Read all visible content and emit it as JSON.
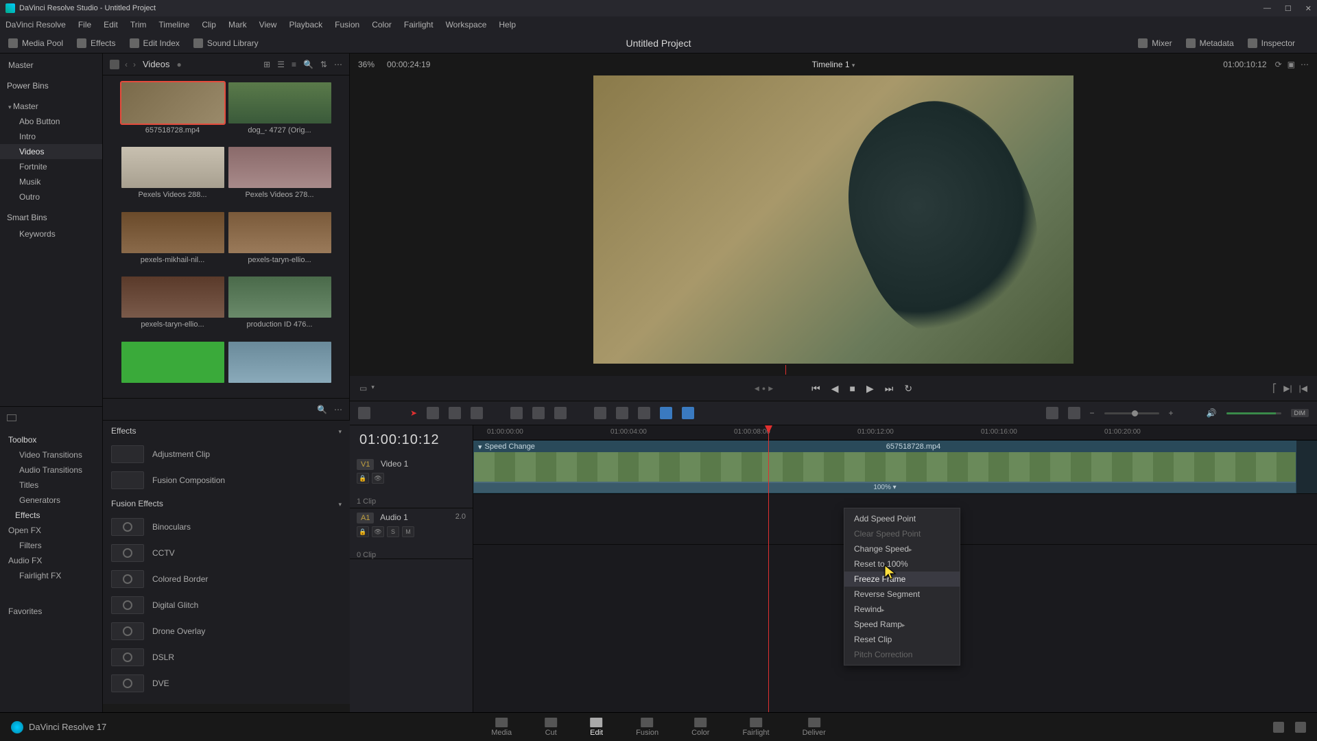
{
  "titlebar": {
    "text": "DaVinci Resolve Studio - Untitled Project"
  },
  "menu": [
    "DaVinci Resolve",
    "File",
    "Edit",
    "Trim",
    "Timeline",
    "Clip",
    "Mark",
    "View",
    "Playback",
    "Fusion",
    "Color",
    "Fairlight",
    "Workspace",
    "Help"
  ],
  "toolbar": {
    "media_pool": "Media Pool",
    "effects": "Effects",
    "edit_index": "Edit Index",
    "sound_library": "Sound Library",
    "mixer": "Mixer",
    "metadata": "Metadata",
    "inspector": "Inspector",
    "project_title": "Untitled Project"
  },
  "viewer_header": {
    "zoom": "36%",
    "tc_left": "00:00:24:19",
    "timeline_name": "Timeline 1",
    "tc_right": "01:00:10:12"
  },
  "media_header": {
    "crumb": "Videos"
  },
  "bins": {
    "master": "Master",
    "power": "Power Bins",
    "pb_master": "Master",
    "items": [
      "Abo Button",
      "Intro",
      "Videos",
      "Fortnite",
      "Musik",
      "Outro"
    ],
    "smart": "Smart Bins",
    "keywords": "Keywords"
  },
  "thumbs": [
    {
      "label": "657518728.mp4",
      "cls": "bg-bike",
      "sel": true
    },
    {
      "label": "dog_- 4727 (Orig...",
      "cls": "bg-dog"
    },
    {
      "label": "Pexels Videos 288...",
      "cls": "bg-wed"
    },
    {
      "label": "Pexels Videos 278...",
      "cls": "bg-fit"
    },
    {
      "label": "pexels-mikhail-nil...",
      "cls": "bg-for"
    },
    {
      "label": "pexels-taryn-ellio...",
      "cls": "bg-for2"
    },
    {
      "label": "pexels-taryn-ellio...",
      "cls": "bg-tree"
    },
    {
      "label": "production ID 476...",
      "cls": "bg-mnt"
    },
    {
      "label": "",
      "cls": "bg-grn"
    },
    {
      "label": "",
      "cls": "bg-face"
    }
  ],
  "efftree": {
    "toolbox": "Toolbox",
    "items1": [
      "Video Transitions",
      "Audio Transitions",
      "Titles",
      "Generators"
    ],
    "effects": "Effects",
    "openfx": "Open FX",
    "filters": "Filters",
    "audiofx": "Audio FX",
    "fairlightfx": "Fairlight FX",
    "favorites": "Favorites"
  },
  "effects_panel": {
    "h1": "Effects",
    "items_a": [
      "Adjustment Clip",
      "Fusion Composition"
    ],
    "h2": "Fusion Effects",
    "items_b": [
      "Binoculars",
      "CCTV",
      "Colored Border",
      "Digital Glitch",
      "Drone Overlay",
      "DSLR",
      "DVE"
    ]
  },
  "timeline": {
    "bigtc": "01:00:10:12",
    "v1": "V1",
    "video1": "Video 1",
    "v1sub": "1 Clip",
    "a1": "A1",
    "audio1": "Audio 1",
    "a1val": "2.0",
    "a1sub": "0 Clip",
    "ruler": [
      "01:00:00:00",
      "01:00:04:00",
      "01:00:08:00",
      "01:00:12:00",
      "01:00:16:00",
      "01:00:20:00"
    ],
    "clip_title": "Speed Change",
    "clip_name": "657518728.mp4",
    "speed_label": "100% ▾",
    "btn_lock": "🔒",
    "btn_eye": "👁",
    "btn_s": "S",
    "btn_m": "M"
  },
  "context_menu": {
    "items": [
      {
        "label": "Add Speed Point",
        "dis": false,
        "sub": false
      },
      {
        "label": "Clear Speed Point",
        "dis": true,
        "sub": false
      },
      {
        "label": "Change Speed",
        "dis": false,
        "sub": true
      },
      {
        "label": "Reset to 100%",
        "dis": false,
        "sub": false
      },
      {
        "label": "Freeze Frame",
        "dis": false,
        "sub": false,
        "hl": true
      },
      {
        "label": "Reverse Segment",
        "dis": false,
        "sub": false
      },
      {
        "label": "Rewind",
        "dis": false,
        "sub": true
      },
      {
        "label": "Speed Ramp",
        "dis": false,
        "sub": true
      },
      {
        "label": "Reset Clip",
        "dis": false,
        "sub": false
      },
      {
        "label": "Pitch Correction",
        "dis": true,
        "sub": false
      }
    ]
  },
  "bottom": {
    "app": "DaVinci Resolve 17",
    "pages": [
      "Media",
      "Cut",
      "Edit",
      "Fusion",
      "Color",
      "Fairlight",
      "Deliver"
    ],
    "active": "Edit"
  }
}
